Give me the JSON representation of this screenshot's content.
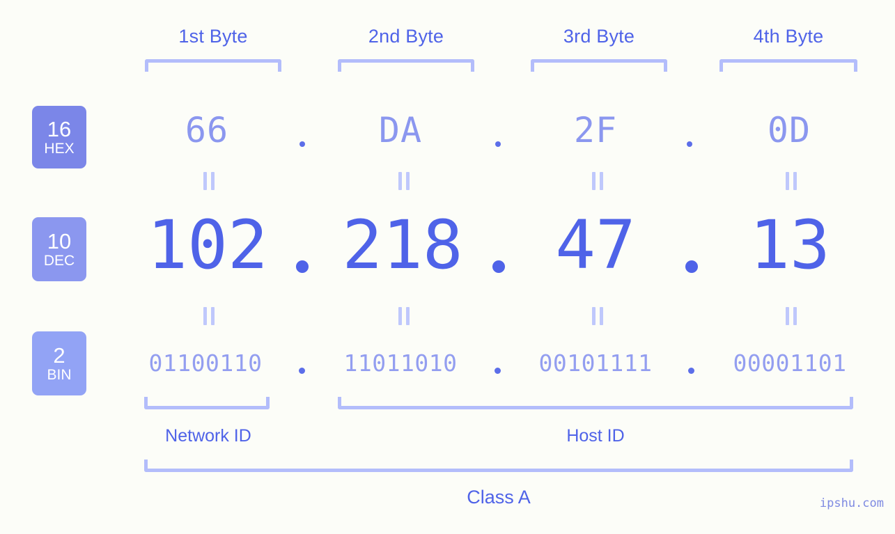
{
  "meta": {
    "watermark": "ipshu.com"
  },
  "header": {
    "byte_labels": [
      "1st Byte",
      "2nd Byte",
      "3rd Byte",
      "4th Byte"
    ]
  },
  "radix_badges": [
    {
      "num": "16",
      "abbr": "HEX",
      "color": "#7b86e8"
    },
    {
      "num": "10",
      "abbr": "DEC",
      "color": "#8b97ef"
    },
    {
      "num": "2",
      "abbr": "BIN",
      "color": "#92a3f5"
    }
  ],
  "rows": {
    "hex": {
      "values": [
        "66",
        "DA",
        "2F",
        "0D"
      ],
      "separator": "."
    },
    "dec": {
      "values": [
        "102",
        "218",
        "47",
        "13"
      ],
      "separator": "."
    },
    "bin": {
      "values": [
        "01100110",
        "11011010",
        "00101111",
        "00001101"
      ],
      "separator": "."
    }
  },
  "equivalence_mark": "=",
  "footer": {
    "network_id_label": "Network ID",
    "host_id_label": "Host ID",
    "class_label": "Class A"
  },
  "colors": {
    "background": "#fcfdf8",
    "accent_strong": "#4f63e8",
    "accent_mid": "#8b97ef",
    "accent_light": "#b3bdfb"
  },
  "chart_data": {
    "type": "table",
    "title": "IP address 102.218.47.13 byte breakdown",
    "columns": [
      "1st Byte",
      "2nd Byte",
      "3rd Byte",
      "4th Byte"
    ],
    "rows": [
      {
        "radix": "HEX (16)",
        "values": [
          "66",
          "DA",
          "2F",
          "0D"
        ]
      },
      {
        "radix": "DEC (10)",
        "values": [
          "102",
          "218",
          "47",
          "13"
        ]
      },
      {
        "radix": "BIN (2)",
        "values": [
          "01100110",
          "11011010",
          "00101111",
          "00001101"
        ]
      }
    ],
    "annotations": {
      "network_id_bytes": [
        "1st Byte"
      ],
      "host_id_bytes": [
        "2nd Byte",
        "3rd Byte",
        "4th Byte"
      ],
      "class": "Class A"
    }
  }
}
